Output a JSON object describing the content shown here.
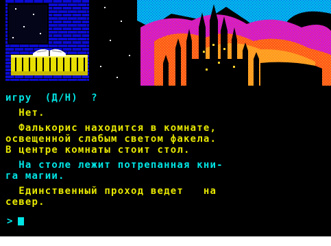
{
  "game": {
    "log": [
      {
        "text": "игру  (Д/Н)  ?",
        "color": "cyan"
      },
      {
        "text": "  Нет.",
        "color": "yellow"
      },
      {
        "text": "  Фалькорис находится в комнате,",
        "color": "yellow"
      },
      {
        "text": "освещенной слабым светом факела.",
        "color": "yellow"
      },
      {
        "text": "В центре комнаты стоит стол.",
        "color": "yellow"
      },
      {
        "text": "  На столе лежит потрепанная кни-",
        "color": "cyan"
      },
      {
        "text": "га магии.",
        "color": "cyan"
      },
      {
        "text": "  Единственный проход ведет   на",
        "color": "yellow"
      },
      {
        "text": "север.",
        "color": "yellow"
      }
    ],
    "prompt_symbol": ">",
    "colors": {
      "cyan": "#00e5e5",
      "yellow": "#e8e800",
      "background": "#000000"
    }
  }
}
